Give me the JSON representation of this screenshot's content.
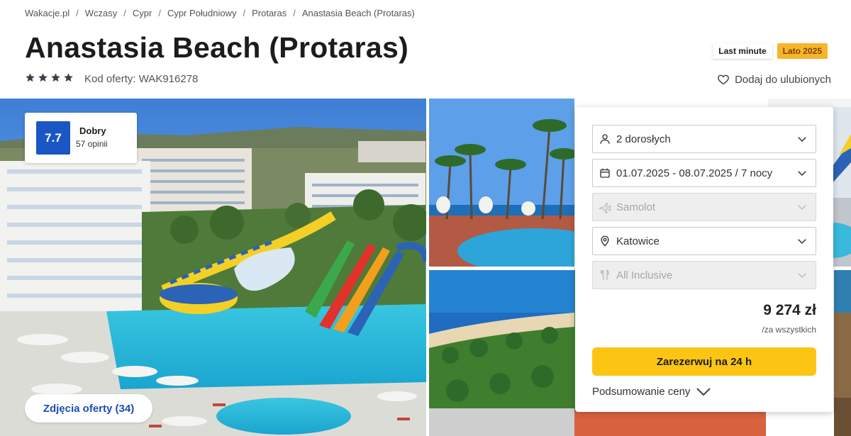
{
  "breadcrumb": [
    "Wakacje.pl",
    "Wczasy",
    "Cypr",
    "Cypr Południowy",
    "Protaras",
    "Anastasia Beach (Protaras)"
  ],
  "breadcrumb_separator": "/",
  "hotel": {
    "name": "Anastasia Beach (Protaras)",
    "stars": 4,
    "offer_code": "Kod oferty: WAK916278"
  },
  "badges": {
    "last_minute": "Last minute",
    "season": "Lato 2025"
  },
  "favorites_label": "Dodaj do ulubionych",
  "rating": {
    "score": "7.7",
    "label": "Dobry",
    "reviews": "57 opinii"
  },
  "photos_button": "Zdjęcia oferty (34)",
  "booking": {
    "guests": "2 dorosłych",
    "dates": "01.07.2025 - 08.07.2025 / 7 nocy",
    "transport": "Samolot",
    "departure": "Katowice",
    "board": "All Inclusive",
    "price": "9 274 zł",
    "price_note": "/za wszystkich",
    "book_button": "Zarezerwuj na 24 h",
    "summary_label": "Podsumowanie ceny"
  },
  "icons": [
    "star-icon",
    "heart-icon",
    "user-icon",
    "calendar-icon",
    "plane-icon",
    "location-pin-icon",
    "cutlery-icon",
    "chevron-down-icon"
  ],
  "colors": {
    "rating_blue": "#1a56c4",
    "book_yellow": "#fcc514",
    "season_badge": "#f7b52c",
    "link_blue": "#1a4fb5"
  }
}
